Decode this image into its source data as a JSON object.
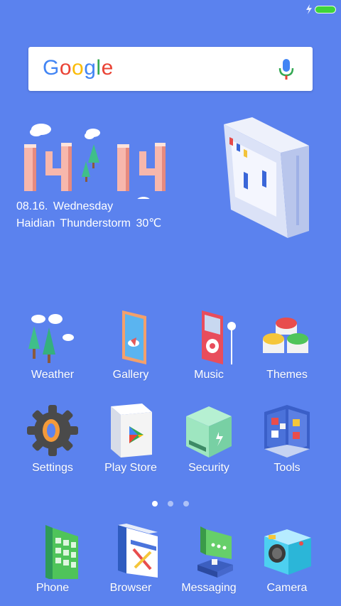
{
  "search": {
    "logo_text": "Google",
    "logo_colors": [
      "#4285f4",
      "#ea4335",
      "#fbbc05",
      "#4285f4",
      "#34a853",
      "#ea4335"
    ]
  },
  "clock": {
    "time_hours": "14",
    "time_minutes": "14",
    "date_line": "08.16. Wednesday",
    "weather_line": "Haidian Thunderstorm 30℃"
  },
  "apps_row1": [
    {
      "label": "Weather"
    },
    {
      "label": "Gallery"
    },
    {
      "label": "Music"
    },
    {
      "label": "Themes"
    }
  ],
  "apps_row2": [
    {
      "label": "Settings"
    },
    {
      "label": "Play Store"
    },
    {
      "label": "Security"
    },
    {
      "label": "Tools"
    }
  ],
  "dock": [
    {
      "label": "Phone"
    },
    {
      "label": "Browser"
    },
    {
      "label": "Messaging"
    },
    {
      "label": "Camera"
    }
  ],
  "pager": {
    "pages": 3,
    "current": 1
  },
  "colors": {
    "background": "#5b82ee",
    "battery": "#3ed43a"
  }
}
